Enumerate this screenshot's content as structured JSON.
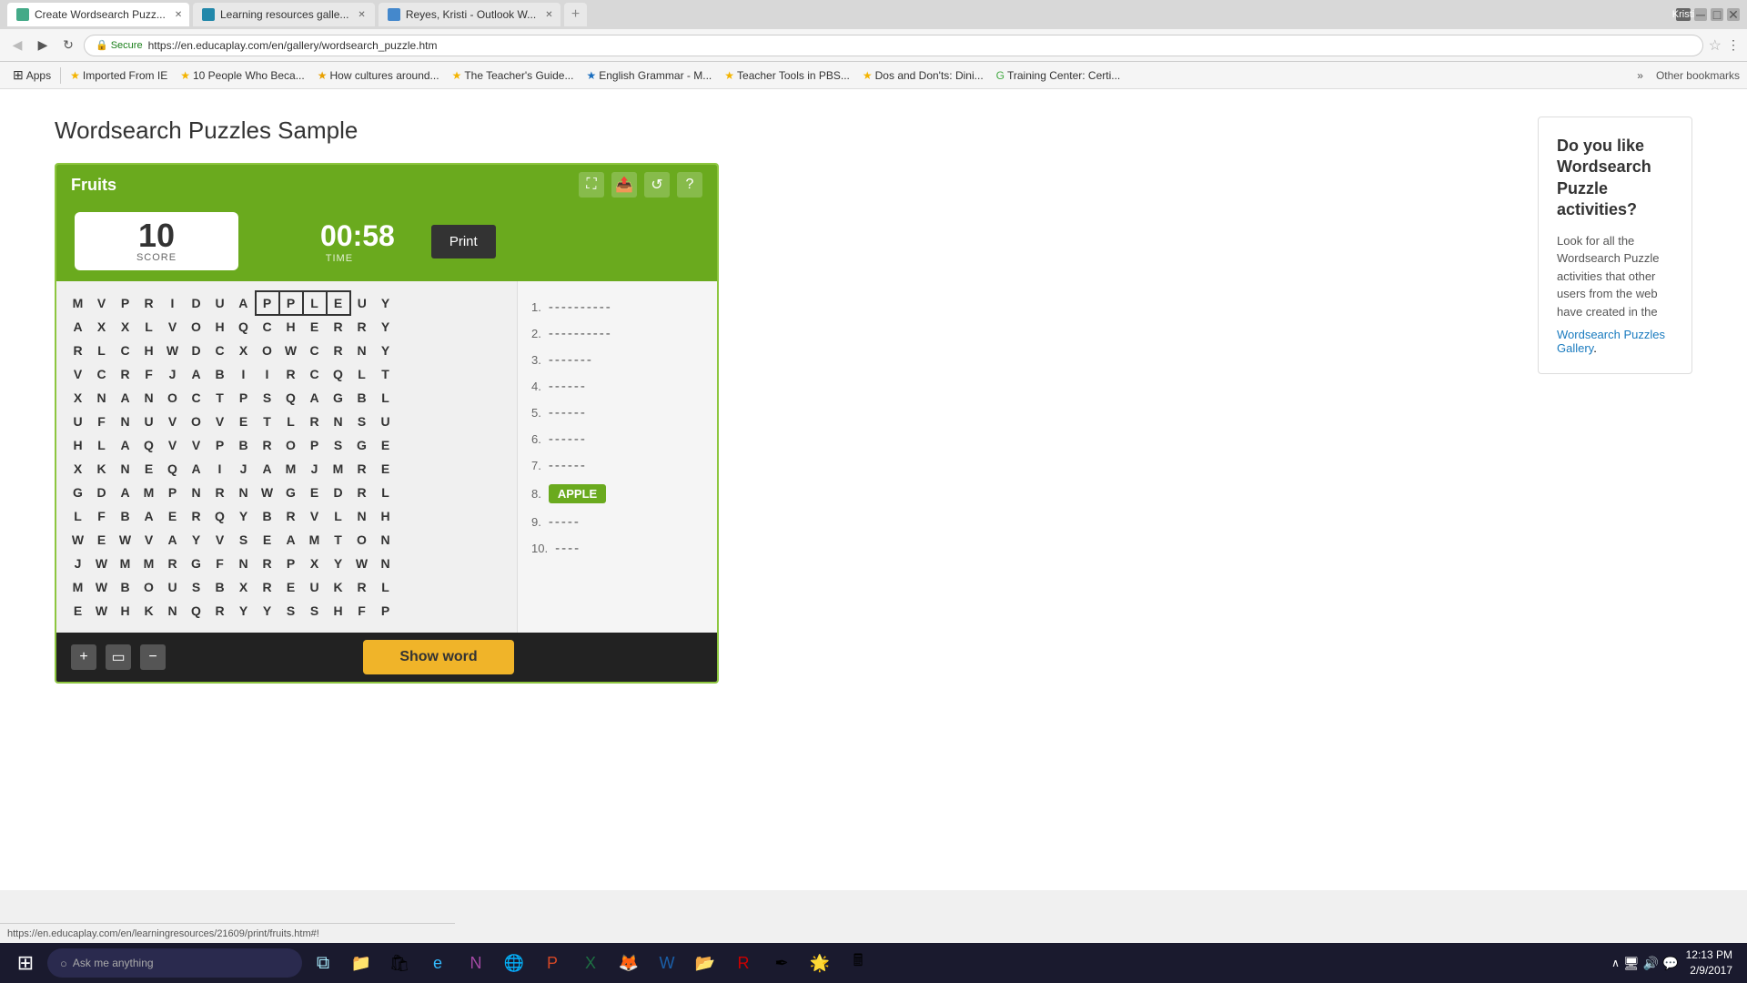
{
  "browser": {
    "user": "Kristi",
    "tabs": [
      {
        "label": "Create Wordsearch Puzz...",
        "active": true,
        "icon": "🔍"
      },
      {
        "label": "Learning resources galle...",
        "active": false,
        "icon": "🎓"
      },
      {
        "label": "Reyes, Kristi - Outlook W...",
        "active": false,
        "icon": "📧"
      }
    ],
    "url": "https://en.educaplay.com/en/gallery/wordsearch_puzzle.htm",
    "secure_label": "Secure"
  },
  "bookmarks": [
    {
      "label": "Apps",
      "icon": "⊞"
    },
    {
      "label": "Imported From IE",
      "icon": "⭐"
    },
    {
      "label": "10 People Who Beca...",
      "icon": "⭐"
    },
    {
      "label": "How cultures around...",
      "icon": "⭐"
    },
    {
      "label": "The Teacher's Guide...",
      "icon": "⭐"
    },
    {
      "label": "English Grammar - M...",
      "icon": "⭐"
    },
    {
      "label": "Teacher Tools in PBS...",
      "icon": "⭐"
    },
    {
      "label": "Dos and Don'ts: Dini...",
      "icon": "⭐"
    },
    {
      "label": "Training Center: Certi...",
      "icon": "⭐"
    }
  ],
  "page": {
    "title": "Wordsearch Puzzles Sample"
  },
  "puzzle": {
    "title": "Fruits",
    "score": "10",
    "score_label": "SCORE",
    "time": "00:58",
    "time_label": "TIME",
    "print_label": "Print",
    "show_word_label": "Show word",
    "grid": [
      [
        "M",
        "V",
        "P",
        "R",
        "I",
        "D",
        "U",
        "A",
        "P",
        "P",
        "L",
        "E",
        "U",
        "Y"
      ],
      [
        "A",
        "X",
        "X",
        "L",
        "V",
        "O",
        "H",
        "Q",
        "C",
        "H",
        "E",
        "R",
        "R",
        "Y"
      ],
      [
        "R",
        "L",
        "C",
        "H",
        "W",
        "D",
        "C",
        "X",
        "O",
        "W",
        "C",
        "R",
        "N",
        "Y"
      ],
      [
        "V",
        "C",
        "R",
        "F",
        "J",
        "A",
        "B",
        "I",
        "I",
        "R",
        "C",
        "Q",
        "L",
        "T"
      ],
      [
        "X",
        "N",
        "A",
        "N",
        "O",
        "C",
        "T",
        "P",
        "S",
        "Q",
        "A",
        "G",
        "B",
        "L"
      ],
      [
        "U",
        "F",
        "N",
        "U",
        "V",
        "O",
        "V",
        "E",
        "T",
        "L",
        "R",
        "N",
        "S",
        "U"
      ],
      [
        "H",
        "L",
        "A",
        "Q",
        "V",
        "V",
        "P",
        "B",
        "R",
        "O",
        "P",
        "S",
        "G",
        "E"
      ],
      [
        "X",
        "K",
        "N",
        "E",
        "Q",
        "A",
        "I",
        "J",
        "A",
        "M",
        "J",
        "M",
        "R",
        "E"
      ],
      [
        "G",
        "D",
        "A",
        "M",
        "P",
        "N",
        "R",
        "N",
        "W",
        "G",
        "E",
        "D",
        "R",
        "L"
      ],
      [
        "L",
        "F",
        "B",
        "A",
        "E",
        "R",
        "Q",
        "Y",
        "B",
        "R",
        "V",
        "L",
        "N",
        "H"
      ],
      [
        "W",
        "E",
        "W",
        "V",
        "A",
        "Y",
        "V",
        "S",
        "E",
        "A",
        "M",
        "T",
        "O",
        "N"
      ],
      [
        "J",
        "W",
        "M",
        "M",
        "R",
        "G",
        "F",
        "N",
        "R",
        "P",
        "X",
        "Y",
        "W",
        "N"
      ],
      [
        "M",
        "W",
        "B",
        "O",
        "U",
        "S",
        "B",
        "X",
        "R",
        "E",
        "U",
        "K",
        "R",
        "L"
      ],
      [
        "E",
        "W",
        "H",
        "K",
        "N",
        "Q",
        "R",
        "Y",
        "Y",
        "S",
        "S",
        "H",
        "F",
        "P"
      ]
    ],
    "highlighted_cells": [
      [
        0,
        8
      ],
      [
        0,
        9
      ],
      [
        0,
        10
      ],
      [
        0,
        11
      ]
    ],
    "word_list": [
      {
        "num": 1,
        "display": "----------",
        "found": false
      },
      {
        "num": 2,
        "display": "----------",
        "found": false
      },
      {
        "num": 3,
        "display": "-------",
        "found": false
      },
      {
        "num": 4,
        "display": "------",
        "found": false
      },
      {
        "num": 5,
        "display": "------",
        "found": false
      },
      {
        "num": 6,
        "display": "------",
        "found": false
      },
      {
        "num": 7,
        "display": "------",
        "found": false
      },
      {
        "num": 8,
        "display": "APPLE",
        "found": true
      },
      {
        "num": 9,
        "display": "-----",
        "found": false
      },
      {
        "num": 10,
        "display": "----",
        "found": false
      }
    ]
  },
  "sidebar": {
    "title": "Do you like Wordsearch Puzzle activities?",
    "body": "Look for all the Wordsearch Puzzle activities that other users from the web have created in the",
    "link_text": "Wordsearch Puzzles Gallery",
    "link_suffix": "."
  },
  "taskbar": {
    "search_placeholder": "Ask me anything",
    "time": "12:13 PM",
    "date": "2/9/2017"
  },
  "status_bar": {
    "url": "https://en.educaplay.com/en/learningresources/21609/print/fruits.htm#!"
  }
}
